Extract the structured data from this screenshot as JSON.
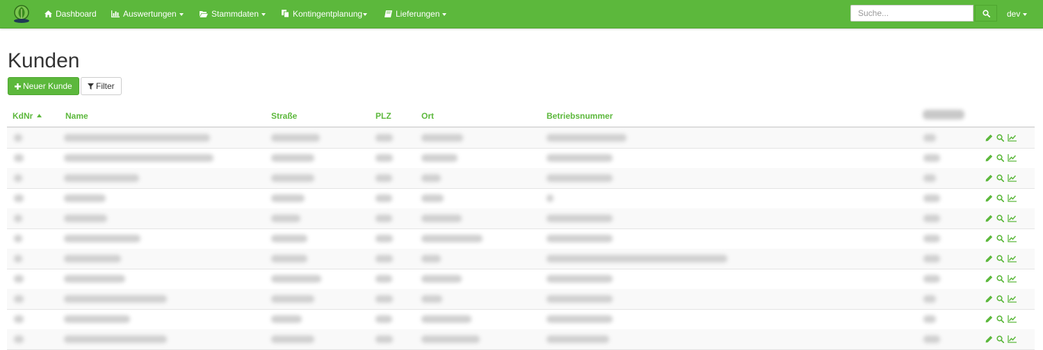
{
  "nav": {
    "items": [
      {
        "label": "Dashboard",
        "icon": "home-icon",
        "caret": false
      },
      {
        "label": "Auswertungen",
        "icon": "bar-chart-icon",
        "caret": true
      },
      {
        "label": "Stammdaten",
        "icon": "folder-open-icon",
        "caret": true
      },
      {
        "label": "Kontingentplanung",
        "icon": "copy-icon",
        "caret": true
      },
      {
        "label": "Lieferungen",
        "icon": "book-icon",
        "caret": true
      }
    ],
    "search_placeholder": "Suche...",
    "user": "dev",
    "accent": "#5cb83c"
  },
  "page": {
    "title": "Kunden",
    "new_button": "Neuer Kunde",
    "filter_button": "Filter"
  },
  "table": {
    "columns": [
      "KdNr",
      "Name",
      "Straße",
      "PLZ",
      "Ort",
      "Betriebsnummer"
    ],
    "sorted_column": "KdNr"
  }
}
